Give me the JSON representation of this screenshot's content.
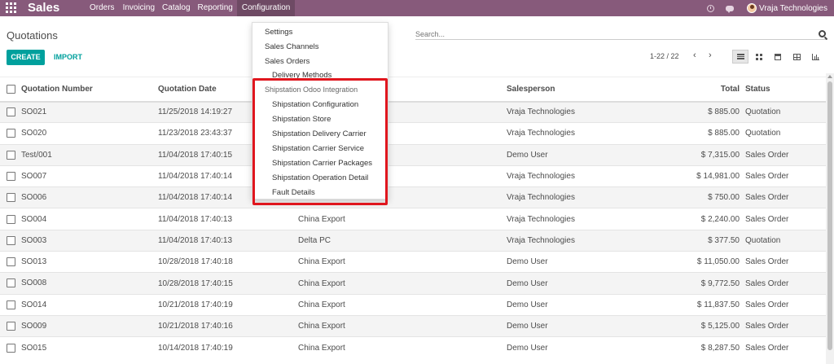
{
  "topbar": {
    "app_title": "Sales",
    "nav": [
      "Orders",
      "Invoicing",
      "Catalog",
      "Reporting",
      "Configuration"
    ],
    "active_nav": "Configuration",
    "user": "Vraja Technologies",
    "color": "#875a7b"
  },
  "control": {
    "title": "Quotations",
    "search_placeholder": "Search...",
    "create_label": "CREATE",
    "import_label": "IMPORT",
    "pager": "1-22 / 22",
    "pager_prev": "‹",
    "pager_next": "›",
    "views": [
      "list-icon",
      "kanban-icon",
      "calendar-icon",
      "pivot-icon",
      "graph-icon"
    ],
    "accent": "#00a09d"
  },
  "table": {
    "headers": {
      "number": "Quotation Number",
      "date": "Quotation Date",
      "customer": "",
      "salesperson": "Salesperson",
      "total": "Total",
      "status": "Status"
    },
    "rows": [
      {
        "number": "SO021",
        "date": "11/25/2018 14:19:27",
        "customer": "",
        "salesperson": "Vraja Technologies",
        "total": "$ 885.00",
        "status": "Quotation"
      },
      {
        "number": "SO020",
        "date": "11/23/2018 23:43:37",
        "customer": "",
        "salesperson": "Vraja Technologies",
        "total": "$ 885.00",
        "status": "Quotation"
      },
      {
        "number": "Test/001",
        "date": "11/04/2018 17:40:15",
        "customer": "",
        "salesperson": "Demo User",
        "total": "$ 7,315.00",
        "status": "Sales Order"
      },
      {
        "number": "SO007",
        "date": "11/04/2018 17:40:14",
        "customer": "",
        "salesperson": "Vraja Technologies",
        "total": "$ 14,981.00",
        "status": "Sales Order"
      },
      {
        "number": "SO006",
        "date": "11/04/2018 17:40:14",
        "customer": "",
        "salesperson": "Vraja Technologies",
        "total": "$ 750.00",
        "status": "Sales Order"
      },
      {
        "number": "SO004",
        "date": "11/04/2018 17:40:13",
        "customer": "China Export",
        "salesperson": "Vraja Technologies",
        "total": "$ 2,240.00",
        "status": "Sales Order"
      },
      {
        "number": "SO003",
        "date": "11/04/2018 17:40:13",
        "customer": "Delta PC",
        "salesperson": "Vraja Technologies",
        "total": "$ 377.50",
        "status": "Quotation"
      },
      {
        "number": "SO013",
        "date": "10/28/2018 17:40:18",
        "customer": "China Export",
        "salesperson": "Demo User",
        "total": "$ 11,050.00",
        "status": "Sales Order"
      },
      {
        "number": "SO008",
        "date": "10/28/2018 17:40:15",
        "customer": "China Export",
        "salesperson": "Demo User",
        "total": "$ 9,772.50",
        "status": "Sales Order"
      },
      {
        "number": "SO014",
        "date": "10/21/2018 17:40:19",
        "customer": "China Export",
        "salesperson": "Demo User",
        "total": "$ 11,837.50",
        "status": "Sales Order"
      },
      {
        "number": "SO009",
        "date": "10/21/2018 17:40:16",
        "customer": "China Export",
        "salesperson": "Demo User",
        "total": "$ 5,125.00",
        "status": "Sales Order"
      },
      {
        "number": "SO015",
        "date": "10/14/2018 17:40:19",
        "customer": "China Export",
        "salesperson": "Demo User",
        "total": "$ 8,287.50",
        "status": "Sales Order"
      }
    ]
  },
  "dropdown": {
    "items": [
      {
        "label": "Settings",
        "level": 0
      },
      {
        "label": "Sales Channels",
        "level": 0
      },
      {
        "label": "Sales Orders",
        "level": 0
      },
      {
        "label": "Delivery Methods",
        "level": 1
      },
      {
        "label": "Shipstation Odoo Integration",
        "level": "header"
      },
      {
        "label": "Shipstation Configuration",
        "level": 1
      },
      {
        "label": "Shipstation Store",
        "level": 1
      },
      {
        "label": "Shipstation Delivery Carrier",
        "level": 1
      },
      {
        "label": "Shipstation Carrier Service",
        "level": 1
      },
      {
        "label": "Shipstation Carrier Packages",
        "level": 1
      },
      {
        "label": "Shipstation Operation Detail",
        "level": 1
      },
      {
        "label": "Fault Details",
        "level": 1
      }
    ],
    "highlight_color": "#e0161e"
  }
}
